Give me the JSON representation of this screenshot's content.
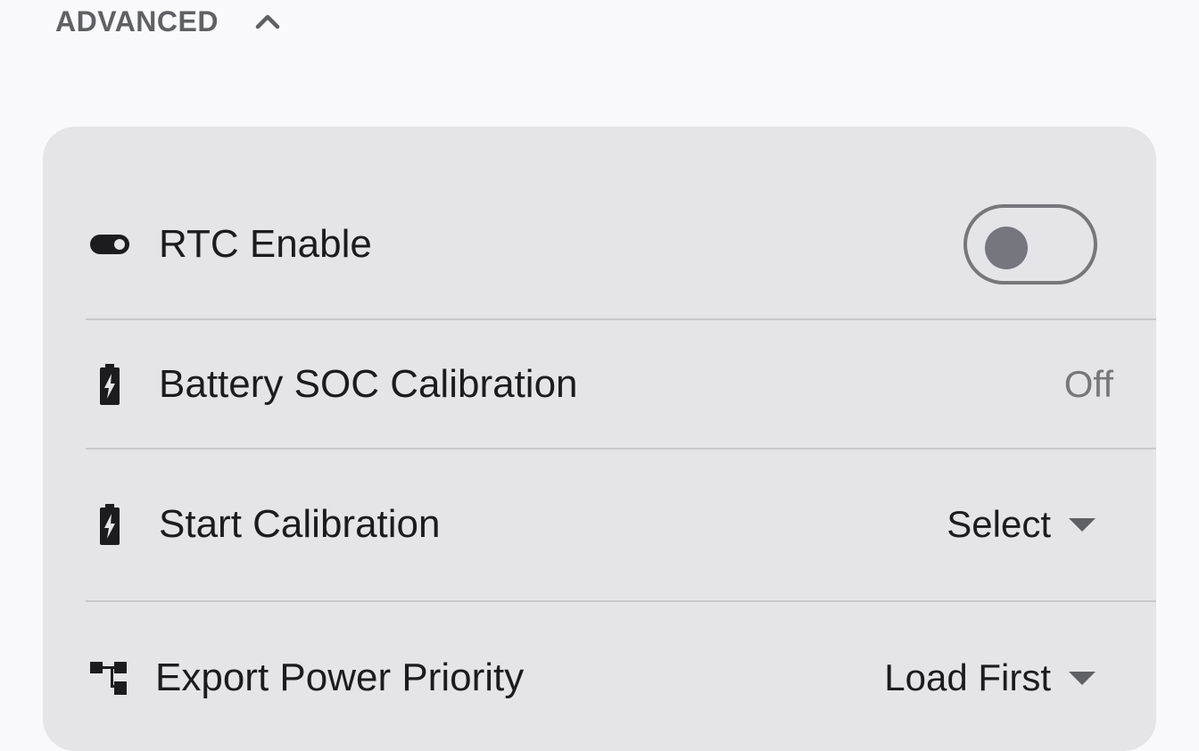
{
  "section": {
    "title": "ADVANCED",
    "toggle_icon": "chevron-up-icon"
  },
  "settings": [
    {
      "label": "RTC Enable",
      "icon": "toggle-icon",
      "control": "switch",
      "enabled": false
    },
    {
      "label": "Battery SOC Calibration",
      "icon": "battery-charging-icon",
      "control": "value",
      "value": "Off"
    },
    {
      "label": "Start Calibration",
      "icon": "battery-charging-icon",
      "control": "dropdown",
      "value": "Select"
    },
    {
      "label": "Export Power Priority",
      "icon": "flow-icon",
      "control": "dropdown",
      "value": "Load First"
    }
  ],
  "colors": {
    "page_background": "#f8f8fd",
    "card_background": "#e5e4e9",
    "divider": "#c9c8cd",
    "text_primary": "#1c1b1f",
    "text_secondary": "#77767c"
  }
}
